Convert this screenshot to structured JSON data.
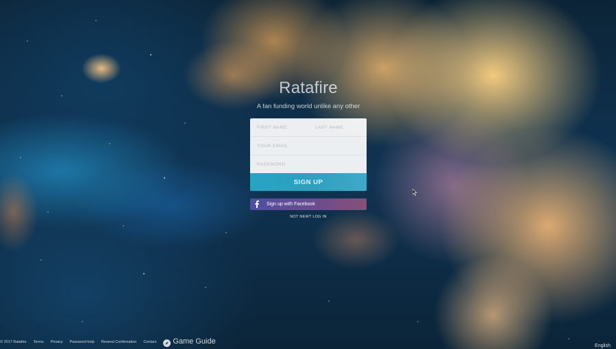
{
  "brand": {
    "title": "Ratafire",
    "tagline": "A fan funding world unlike any other"
  },
  "signup_form": {
    "first_name_placeholder": "FIRST NAME",
    "last_name_placeholder": "LAST NAME",
    "email_placeholder": "YOUR EMAIL",
    "password_placeholder": "PASSWORD",
    "submit_label": "SIGN UP"
  },
  "facebook": {
    "label": "Sign up with Facebook",
    "icon": "facebook-icon"
  },
  "login_link": "NOT NEW? LOG IN",
  "footer": {
    "copyright": "© 2017 Ratafire",
    "links": [
      "Terms",
      "Privacy",
      "Password help",
      "Resend Confirmation",
      "Contact"
    ],
    "game_guide": "Game Guide",
    "game_guide_icon": "compass-icon",
    "language": "English"
  },
  "colors": {
    "signup_button": "#2e9fbf",
    "facebook_button": "#5b4e98"
  }
}
